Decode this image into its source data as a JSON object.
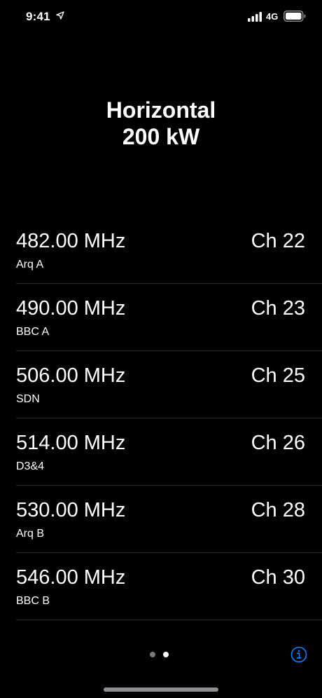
{
  "status_bar": {
    "time": "9:41",
    "network": "4G",
    "icons": [
      "location-arrow-icon",
      "cellular-signal-icon",
      "battery-icon"
    ]
  },
  "header": {
    "line1": "Horizontal",
    "line2": "200 kW"
  },
  "channels": [
    {
      "frequency": "482.00 MHz",
      "mux": "Arq A",
      "channel": "Ch 22"
    },
    {
      "frequency": "490.00 MHz",
      "mux": "BBC A",
      "channel": "Ch 23"
    },
    {
      "frequency": "506.00 MHz",
      "mux": "SDN",
      "channel": "Ch 25"
    },
    {
      "frequency": "514.00 MHz",
      "mux": "D3&4",
      "channel": "Ch 26"
    },
    {
      "frequency": "530.00 MHz",
      "mux": "Arq B",
      "channel": "Ch 28"
    },
    {
      "frequency": "546.00 MHz",
      "mux": "BBC B",
      "channel": "Ch 30"
    }
  ],
  "pager": {
    "page_count": 2,
    "current_page": 2
  },
  "info_button": {
    "icon": "info-circle-icon"
  },
  "colors": {
    "background": "#000000",
    "text": "#ffffff",
    "accent": "#0a84ff",
    "separator": "#2a2a2c"
  }
}
